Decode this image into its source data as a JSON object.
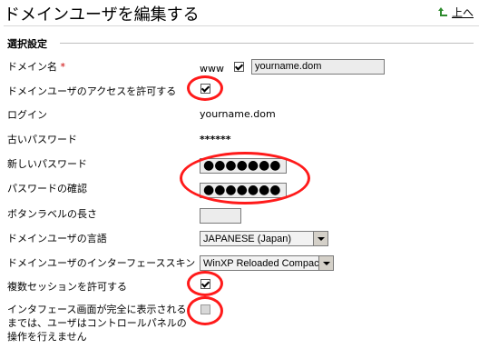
{
  "header": {
    "title": "ドメインユーザを編集する",
    "up_label": "上へ"
  },
  "section": {
    "label": "選択設定"
  },
  "fields": {
    "domain_name": {
      "label": "ドメイン名",
      "required_mark": "*",
      "prefix": "www",
      "www_checked": true,
      "value": "yourname.dom"
    },
    "allow_access": {
      "label": "ドメインユーザのアクセスを許可する",
      "checked": true
    },
    "login": {
      "label": "ログイン",
      "value": "yourname.dom"
    },
    "old_password": {
      "label": "古いパスワード",
      "value": "******"
    },
    "new_password": {
      "label": "新しいパスワード",
      "value": "●●●●●●●"
    },
    "confirm_password": {
      "label": "パスワードの確認",
      "value": "●●●●●●●"
    },
    "button_label_length": {
      "label": "ボタンラベルの長さ",
      "value": ""
    },
    "language": {
      "label": "ドメインユーザの言語",
      "selected": "JAPANESE (Japan)"
    },
    "skin": {
      "label": "ドメインユーザのインターフェーススキン",
      "selected": "WinXP Reloaded Compact"
    },
    "multiple_sessions": {
      "label": "複数セッションを許可する",
      "checked": true
    },
    "lock_until_loaded": {
      "label": "インタフェース画面が完全に表示されるまでは、ユーザはコントロールパネルの操作を行えません",
      "checked": false
    }
  }
}
